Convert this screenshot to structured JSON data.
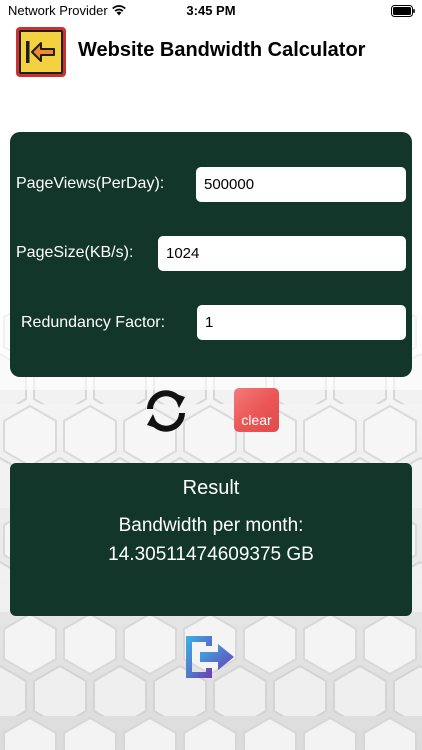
{
  "status_bar": {
    "provider": "Network Provider",
    "time": "3:45 PM"
  },
  "header": {
    "title": "Website Bandwidth Calculator"
  },
  "form": {
    "pageviews_label": "PageViews(PerDay):",
    "pageviews_value": "500000",
    "pagesize_label": "PageSize(KB/s):",
    "pagesize_value": "1024",
    "redundancy_label": "Redundancy Factor:",
    "redundancy_value": "1"
  },
  "actions": {
    "clear_label": "clear"
  },
  "result": {
    "title": "Result",
    "label": "Bandwidth per month:",
    "value": "14.30511474609375 GB"
  },
  "colors": {
    "card_bg": "#13362a",
    "clear_button": "#ea5555",
    "back_button_border": "#c9322d",
    "back_button_fill": "#f4d23f"
  },
  "icons": {
    "back": "arrow-left-icon",
    "refresh": "refresh-icon",
    "exit": "exit-icon"
  }
}
